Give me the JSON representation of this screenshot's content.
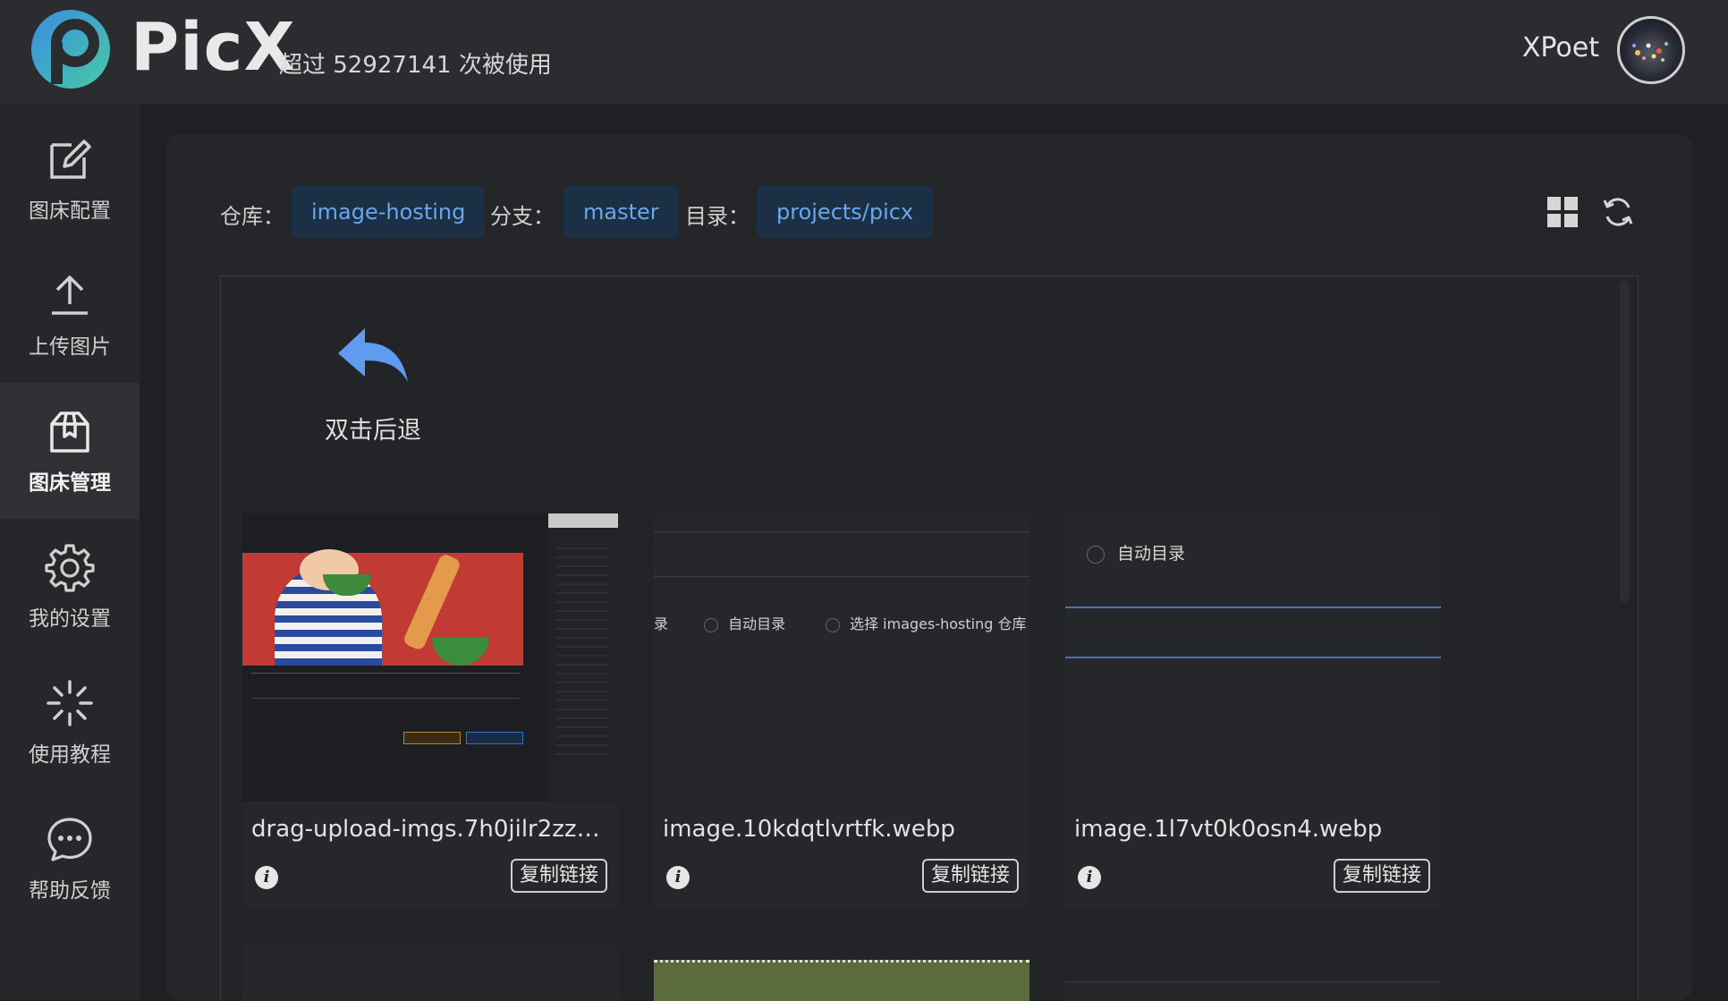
{
  "header": {
    "brand": "PicX",
    "usage_text": "超过 52927141 次被使用",
    "username": "XPoet"
  },
  "sidebar": {
    "items": [
      {
        "label": "图床配置",
        "icon": "edit-icon",
        "active": false
      },
      {
        "label": "上传图片",
        "icon": "upload-icon",
        "active": false
      },
      {
        "label": "图床管理",
        "icon": "box-icon",
        "active": true
      },
      {
        "label": "我的设置",
        "icon": "gear-icon",
        "active": false
      },
      {
        "label": "使用教程",
        "icon": "sparkle-icon",
        "active": false
      },
      {
        "label": "帮助反馈",
        "icon": "chat-icon",
        "active": false
      }
    ]
  },
  "toolbar": {
    "repo_label": "仓库：",
    "repo_value": "image-hosting",
    "branch_label": "分支：",
    "branch_value": "master",
    "dir_label": "目录：",
    "dir_value": "projects/picx",
    "grid_icon": "grid-icon",
    "refresh_icon": "refresh-icon"
  },
  "back": {
    "label": "双击后退",
    "icon": "back-arrow-icon"
  },
  "cards": [
    {
      "filename": "drag-upload-imgs.7h0jilr2zzc...",
      "copy_label": "复制链接"
    },
    {
      "filename": "image.10kdqtlvrtfk.webp",
      "copy_label": "复制链接",
      "thumb_texts": [
        "录",
        "自动目录",
        "选择 images-hosting 仓库"
      ]
    },
    {
      "filename": "image.1l7vt0k0osn4.webp",
      "copy_label": "复制链接",
      "thumb_texts": [
        "自动目录"
      ]
    }
  ],
  "colors": {
    "chip_bg": "#1b2f45",
    "chip_text": "#69a7ef",
    "accent_blue": "#5f9cf0"
  }
}
